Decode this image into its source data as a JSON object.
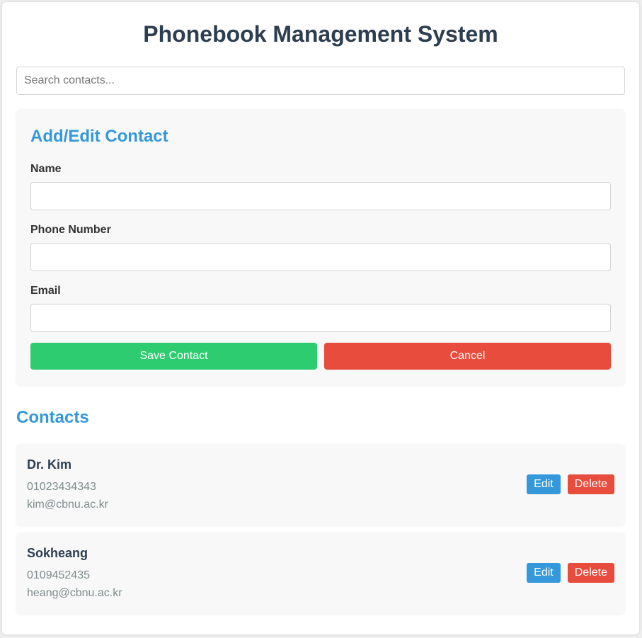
{
  "header": {
    "title": "Phonebook Management System"
  },
  "search": {
    "placeholder": "Search contacts...",
    "value": ""
  },
  "form": {
    "title": "Add/Edit Contact",
    "fields": [
      {
        "label": "Name",
        "value": ""
      },
      {
        "label": "Phone Number",
        "value": ""
      },
      {
        "label": "Email",
        "value": ""
      }
    ],
    "save_label": "Save Contact",
    "cancel_label": "Cancel"
  },
  "contacts": {
    "title": "Contacts",
    "items": [
      {
        "name": "Dr. Kim",
        "phone": "01023434343",
        "email": "kim@cbnu.ac.kr",
        "edit_label": "Edit",
        "delete_label": "Delete"
      },
      {
        "name": "Sokheang",
        "phone": "0109452435",
        "email": "heang@cbnu.ac.kr",
        "edit_label": "Edit",
        "delete_label": "Delete"
      }
    ]
  },
  "colors": {
    "accent_blue": "#3498db",
    "save_green": "#2ecc71",
    "danger_red": "#e74c3c",
    "title_dark": "#2c3e50"
  }
}
